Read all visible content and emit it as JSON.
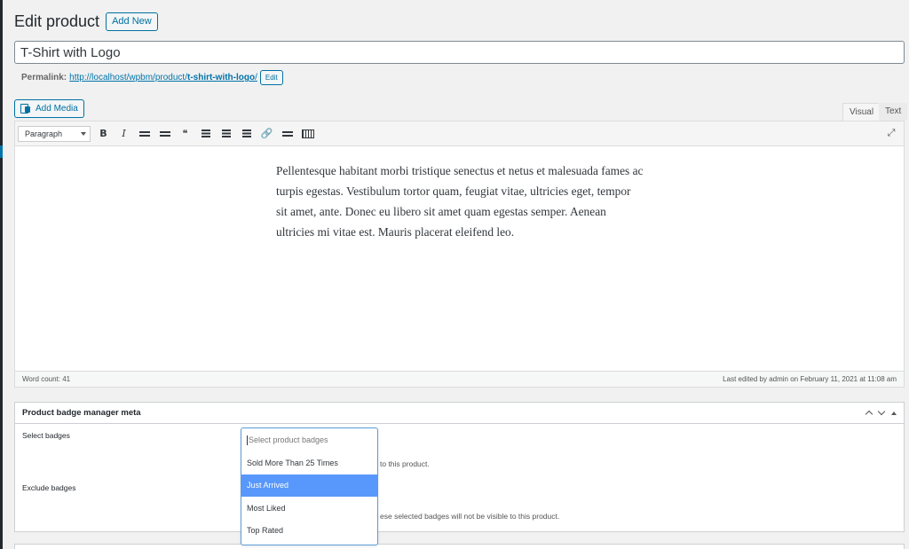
{
  "header": {
    "title": "Edit product",
    "add_new_label": "Add New"
  },
  "product": {
    "title": "T-Shirt with Logo"
  },
  "permalink": {
    "label": "Permalink:",
    "base": "http://localhost/wpbm/product/",
    "slug": "t-shirt-with-logo",
    "trailing": "/",
    "edit_label": "Edit"
  },
  "media": {
    "add_media_label": "Add Media"
  },
  "editor": {
    "tabs": [
      {
        "label": "Visual",
        "active": true
      },
      {
        "label": "Text",
        "active": false
      }
    ],
    "format_select": "Paragraph",
    "toolbar_icons": [
      "bold-icon",
      "italic-icon",
      "bullet-list-icon",
      "numbered-list-icon",
      "blockquote-icon",
      "align-left-icon",
      "align-center-icon",
      "align-right-icon",
      "link-icon",
      "read-more-icon",
      "toolbar-toggle-icon",
      "fullscreen-icon"
    ],
    "toolbar": {
      "bold": "B",
      "italic": "I",
      "blockquote": "❝",
      "link": "🔗",
      "fullscreen": "⤢"
    },
    "content": "Pellentesque habitant morbi tristique senectus et netus et malesuada fames ac turpis egestas. Vestibulum tortor quam, feugiat vitae, ultricies eget, tempor sit amet, ante. Donec eu libero sit amet quam egestas semper. Aenean ultricies mi vitae est. Mauris placerat eleifend leo.",
    "word_count": "Word count: 41",
    "last_edited": "Last edited by admin on February 11, 2021 at 11:08 am"
  },
  "badge_meta": {
    "title": "Product badge manager meta",
    "select_label": "Select badges",
    "exclude_label": "Exclude badges",
    "select_desc_tail": "to this product.",
    "exclude_desc_tail": "ese selected badges will not be visible to this product.",
    "dropdown": {
      "placeholder": "Select product badges",
      "options": [
        {
          "label": "Sold More Than 25 Times",
          "highlighted": false
        },
        {
          "label": "Just Arrived",
          "highlighted": true
        },
        {
          "label": "Most Liked",
          "highlighted": false
        },
        {
          "label": "Top Rated",
          "highlighted": false
        }
      ]
    }
  },
  "colors": {
    "accent": "#0071a1",
    "highlight": "#5897fb",
    "background": "#f1f1f1"
  }
}
